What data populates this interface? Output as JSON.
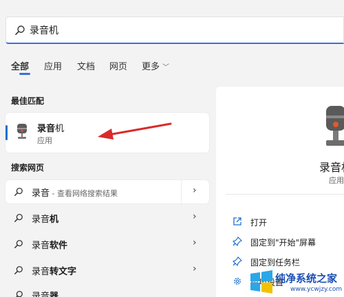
{
  "search": {
    "query": "录音机"
  },
  "tabs": [
    {
      "label": "全部",
      "active": true
    },
    {
      "label": "应用",
      "active": false
    },
    {
      "label": "文档",
      "active": false
    },
    {
      "label": "网页",
      "active": false
    },
    {
      "label": "更多",
      "active": false
    }
  ],
  "best_match": {
    "section_title": "最佳匹配",
    "app_name_bold": "录音",
    "app_name_rest": "机",
    "app_type": "应用"
  },
  "web_search": {
    "section_title": "搜索网页",
    "items": [
      {
        "plain": "录音",
        "bold": "",
        "hint": " - 查看网络搜索结果"
      },
      {
        "plain": "录音",
        "bold": "机",
        "hint": ""
      },
      {
        "plain": "录音",
        "bold": "软件",
        "hint": ""
      },
      {
        "plain": "录音",
        "bold": "转文字",
        "hint": ""
      },
      {
        "plain": "录音",
        "bold": "器",
        "hint": ""
      }
    ]
  },
  "preview": {
    "app_name": "录音机",
    "app_type": "应用",
    "actions": [
      {
        "label": "打开",
        "icon": "open-icon"
      },
      {
        "label": "固定到\"开始\"屏幕",
        "icon": "pin-icon"
      },
      {
        "label": "固定到任务栏",
        "icon": "pin-icon"
      },
      {
        "label": "应用设置",
        "icon": "gear-icon"
      }
    ]
  },
  "watermark": {
    "title": "纯净系统之家",
    "url": "www.ycwjzy.com"
  },
  "colors": {
    "accent": "#3a6fd8",
    "arrow": "#d92b2b",
    "watermark": "#1a4fb5"
  }
}
